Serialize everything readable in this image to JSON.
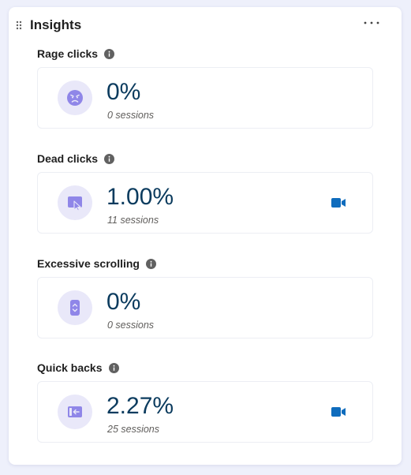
{
  "header": {
    "title": "Insights"
  },
  "metrics": [
    {
      "label": "Rage clicks",
      "value": "0%",
      "sessions": "0 sessions",
      "icon": "angry-face-icon",
      "has_recording": false
    },
    {
      "label": "Dead clicks",
      "value": "1.00%",
      "sessions": "11 sessions",
      "icon": "cursor-square-icon",
      "has_recording": true
    },
    {
      "label": "Excessive scrolling",
      "value": "0%",
      "sessions": "0 sessions",
      "icon": "scroll-arrows-icon",
      "has_recording": false
    },
    {
      "label": "Quick backs",
      "value": "2.27%",
      "sessions": "25 sessions",
      "icon": "back-arrow-icon",
      "has_recording": true
    }
  ],
  "colors": {
    "value_text": "#0b3b5e",
    "icon_circle": "#e9e8f9",
    "icon_fill": "#8f86e8",
    "recording_icon": "#0f6cbd"
  }
}
